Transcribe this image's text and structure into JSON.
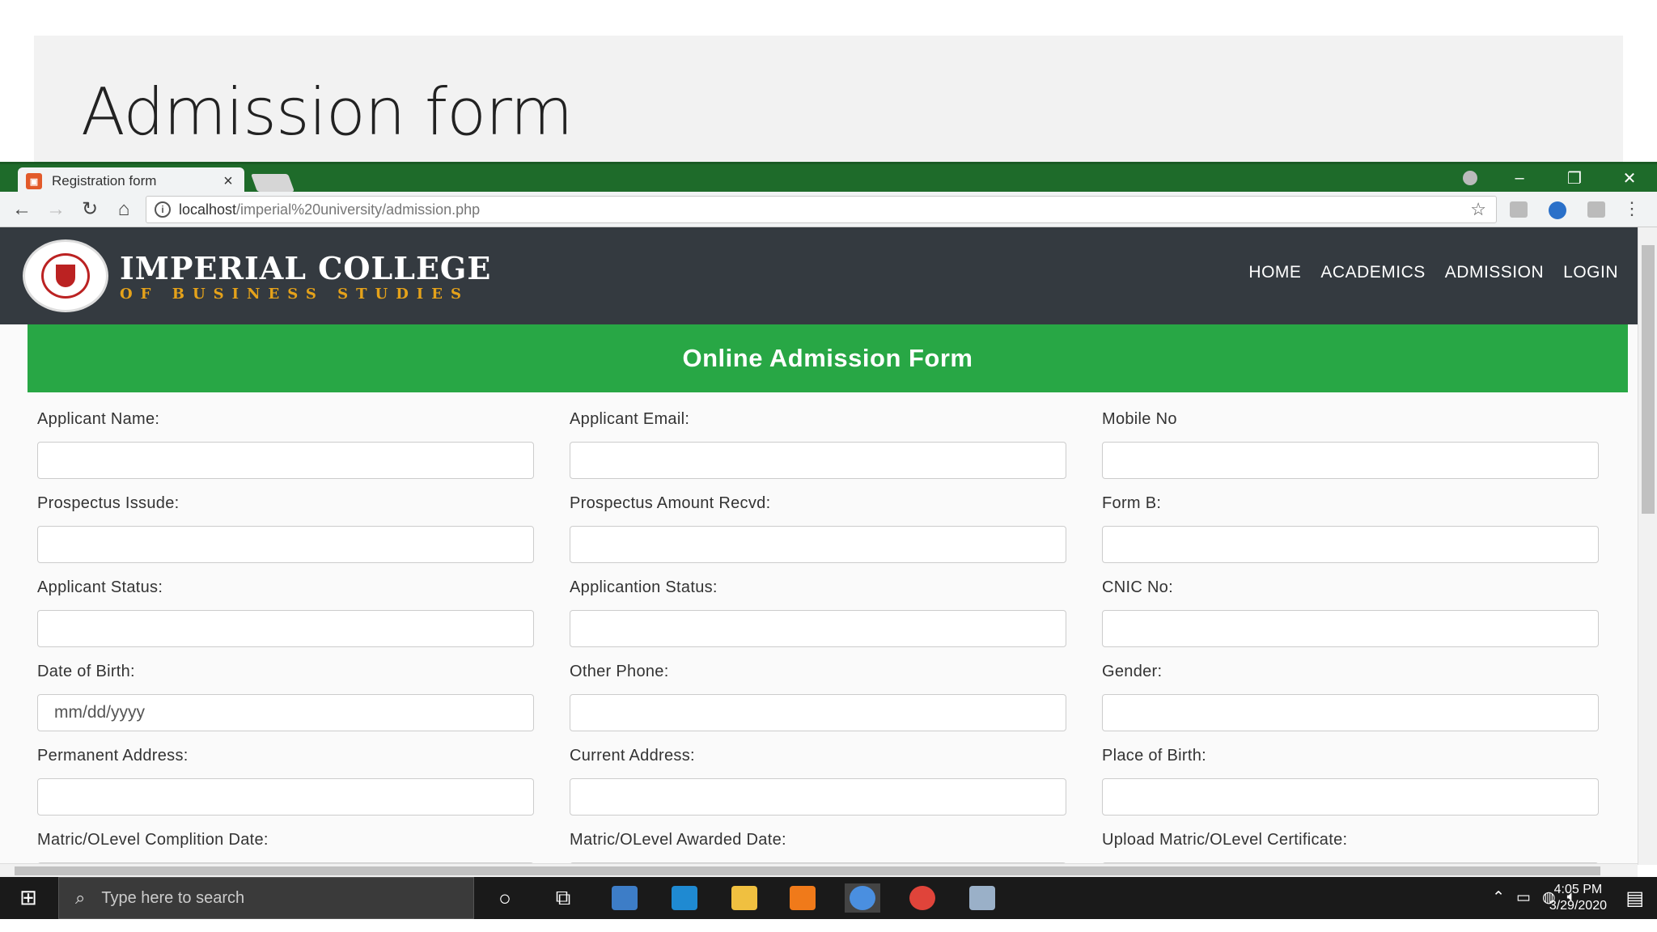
{
  "slide": {
    "title": "Admission form"
  },
  "browser": {
    "tab_title": "Registration form",
    "url_host": "localhost",
    "url_path": "/imperial%20university/admission.php"
  },
  "site": {
    "brand_name": "IMPERIAL COLLEGE",
    "brand_sub": "OF BUSINESS STUDIES",
    "nav": [
      "HOME",
      "ACADEMICS",
      "ADMISSION",
      "LOGIN"
    ],
    "banner_title": "Online Admission Form"
  },
  "form": {
    "fields": [
      {
        "label": "Applicant Name:",
        "value": "",
        "placeholder": ""
      },
      {
        "label": "Applicant Email:",
        "value": "",
        "placeholder": ""
      },
      {
        "label": "Mobile No",
        "value": "",
        "placeholder": ""
      },
      {
        "label": "Prospectus Issude:",
        "value": "",
        "placeholder": ""
      },
      {
        "label": "Prospectus Amount Recvd:",
        "value": "",
        "placeholder": ""
      },
      {
        "label": "Form B:",
        "value": "",
        "placeholder": ""
      },
      {
        "label": "Applicant Status:",
        "value": "",
        "placeholder": ""
      },
      {
        "label": "Applicantion Status:",
        "value": "",
        "placeholder": ""
      },
      {
        "label": "CNIC No:",
        "value": "",
        "placeholder": ""
      },
      {
        "label": "Date of Birth:",
        "value": "",
        "placeholder": "mm/dd/yyyy"
      },
      {
        "label": "Other Phone:",
        "value": "",
        "placeholder": ""
      },
      {
        "label": "Gender:",
        "value": "",
        "placeholder": ""
      },
      {
        "label": "Permanent Address:",
        "value": "",
        "placeholder": ""
      },
      {
        "label": "Current Address:",
        "value": "",
        "placeholder": ""
      },
      {
        "label": "Place of Birth:",
        "value": "",
        "placeholder": ""
      },
      {
        "label": "Matric/OLevel Complition Date:",
        "value": "",
        "placeholder": ""
      },
      {
        "label": "Matric/OLevel Awarded Date:",
        "value": "",
        "placeholder": ""
      },
      {
        "label": "Upload Matric/OLevel Certificate:",
        "value": "",
        "placeholder": ""
      }
    ]
  },
  "taskbar": {
    "search_placeholder": "Type here to search",
    "time": "4:05 PM",
    "date": "3/29/2020"
  },
  "colors": {
    "header_bg": "#343a40",
    "banner_green": "#28a745",
    "brand_gold": "#e5a21a",
    "browser_frame": "#1e6b2a"
  }
}
